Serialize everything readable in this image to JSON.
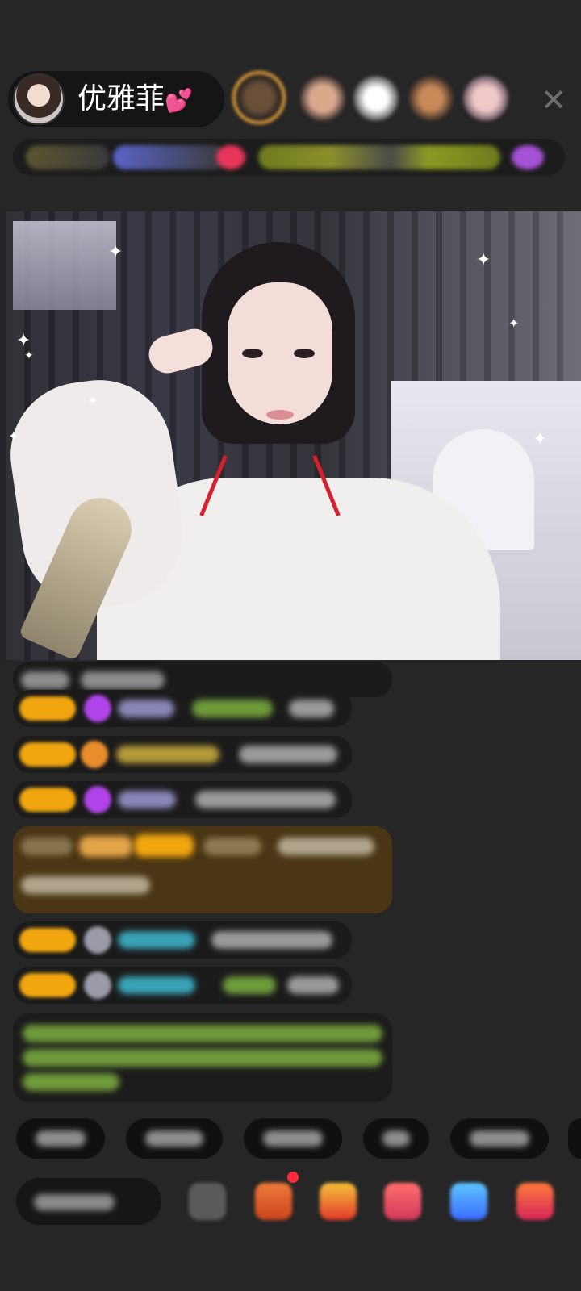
{
  "host": {
    "name": "优雅菲",
    "decor": "💕"
  },
  "header": {
    "close_icon": "close-icon"
  },
  "colors": {
    "background": "#262626",
    "badge_gold": "#f1a60f",
    "chat_green": "#7dbb3a",
    "chat_cyan": "#35c2d6",
    "notification_red": "#ff2d3c"
  }
}
